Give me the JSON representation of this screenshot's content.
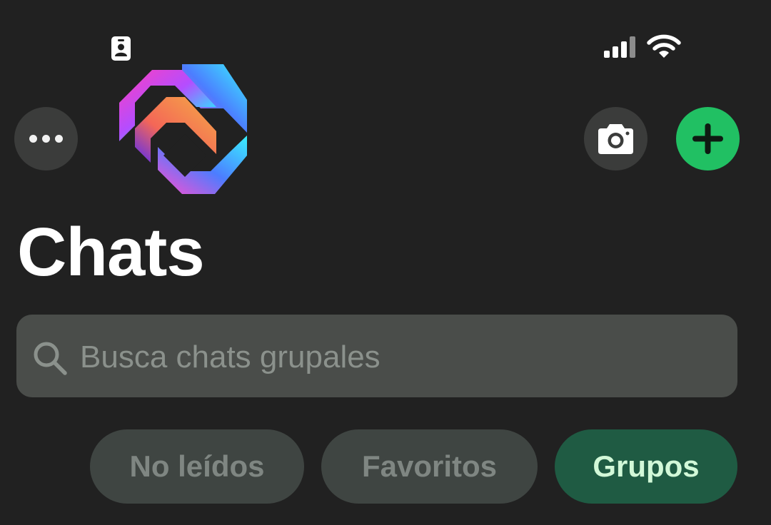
{
  "status_bar": {
    "left_icon": "person-badge-icon",
    "right_icons": [
      "cellular-signal-icon",
      "wifi-icon"
    ]
  },
  "header": {
    "menu_icon": "more-horizontal-icon",
    "logo_icon": "gradient-hexagon-logo-icon",
    "camera_icon": "camera-icon",
    "new_chat_icon": "plus-icon",
    "new_chat_color": "#21c063"
  },
  "title": "Chats",
  "search": {
    "placeholder": "Busca chats grupales",
    "value": ""
  },
  "filters": [
    {
      "label": "No leídos",
      "active": false
    },
    {
      "label": "Favoritos",
      "active": false
    },
    {
      "label": "Grupos",
      "active": true
    }
  ],
  "colors": {
    "background": "#212121",
    "chip_inactive": "#3f4542",
    "chip_active": "#1f5b43",
    "chip_active_text": "#d2f8d8"
  }
}
